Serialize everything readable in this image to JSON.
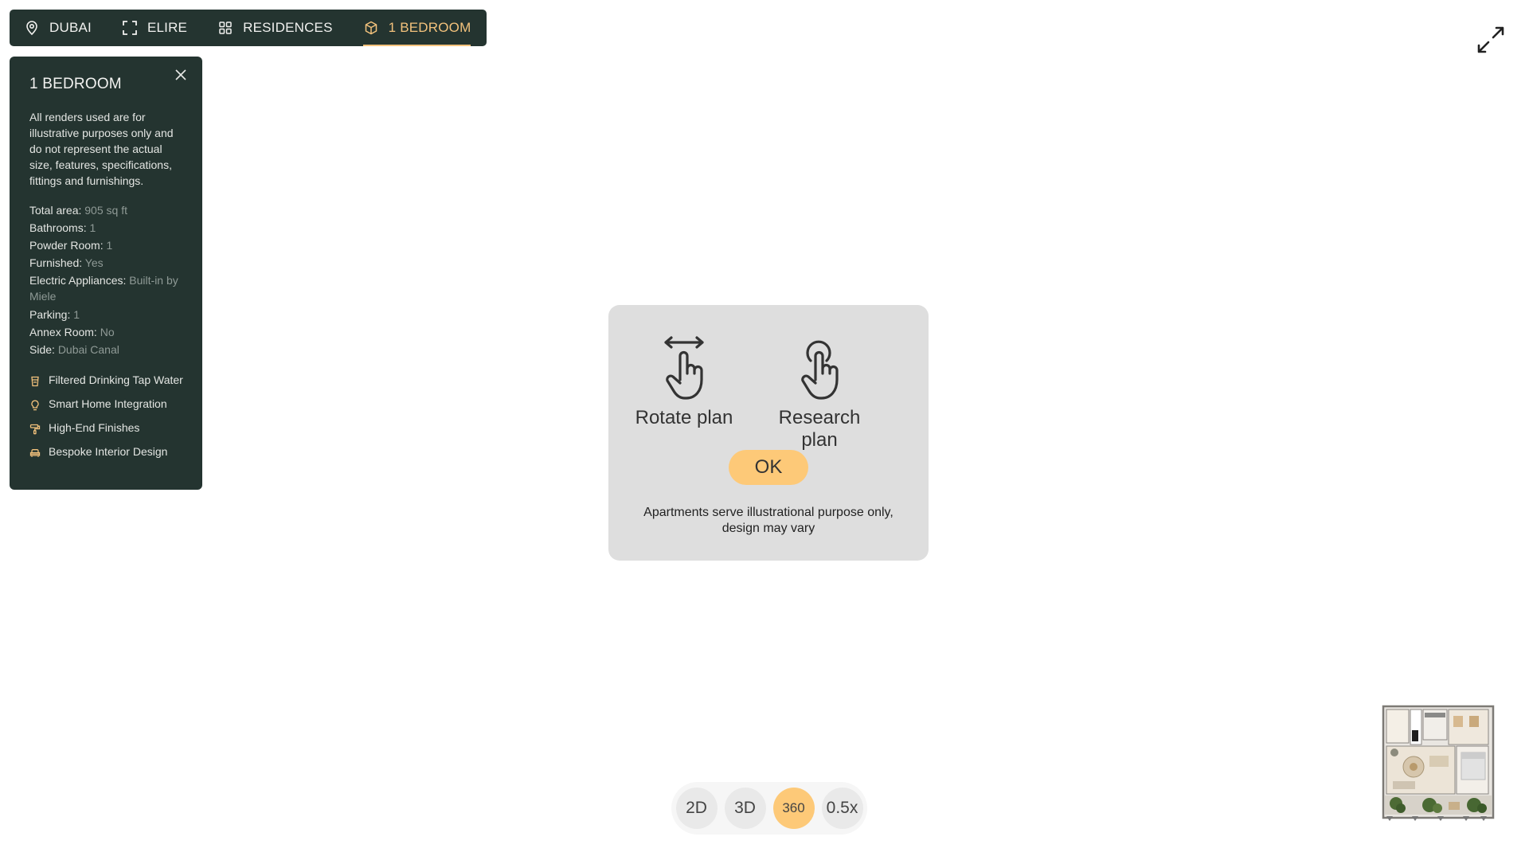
{
  "nav": {
    "items": [
      {
        "label": "DUBAI",
        "icon": "map-pin-icon"
      },
      {
        "label": "ELIRE",
        "icon": "frame-corners-icon"
      },
      {
        "label": "RESIDENCES",
        "icon": "grid-icon"
      },
      {
        "label": "1 BEDROOM",
        "icon": "cube-icon",
        "active": true
      }
    ]
  },
  "panel": {
    "title": "1 BEDROOM",
    "disclaimer": "All renders used are for illustrative purposes only and do not represent the actual size, features, specifications, fittings and furnishings.",
    "specs": [
      {
        "label": "Total area:",
        "value": "905 sq ft"
      },
      {
        "label": "Bathrooms:",
        "value": "1"
      },
      {
        "label": "Powder Room:",
        "value": "1"
      },
      {
        "label": "Furnished:",
        "value": "Yes"
      },
      {
        "label": "Electric Appliances:",
        "value": "Built-in by Miele"
      },
      {
        "label": "Parking:",
        "value": "1"
      },
      {
        "label": "Annex Room:",
        "value": "No"
      },
      {
        "label": "Side:",
        "value": "Dubai Canal"
      }
    ],
    "features": [
      {
        "label": "Filtered Drinking Tap Water",
        "icon": "water-filter-icon"
      },
      {
        "label": "Smart Home Integration",
        "icon": "lightbulb-icon"
      },
      {
        "label": "High-End Finishes",
        "icon": "paint-roller-icon"
      },
      {
        "label": "Bespoke Interior Design",
        "icon": "sofa-icon"
      }
    ]
  },
  "dialog": {
    "rotate_label": "Rotate plan",
    "research_label": "Research plan",
    "ok_label": "OK",
    "note": "Apartments serve illustrational purpose only, design may vary"
  },
  "viewmodes": [
    {
      "label": "2D"
    },
    {
      "label": "3D"
    },
    {
      "label": "360",
      "active": true
    },
    {
      "label": "0.5x"
    }
  ],
  "colors": {
    "panel_bg": "#243430",
    "accent": "#f3c27c",
    "button_yellow": "#fdc978",
    "dialog_bg": "#dedede"
  }
}
